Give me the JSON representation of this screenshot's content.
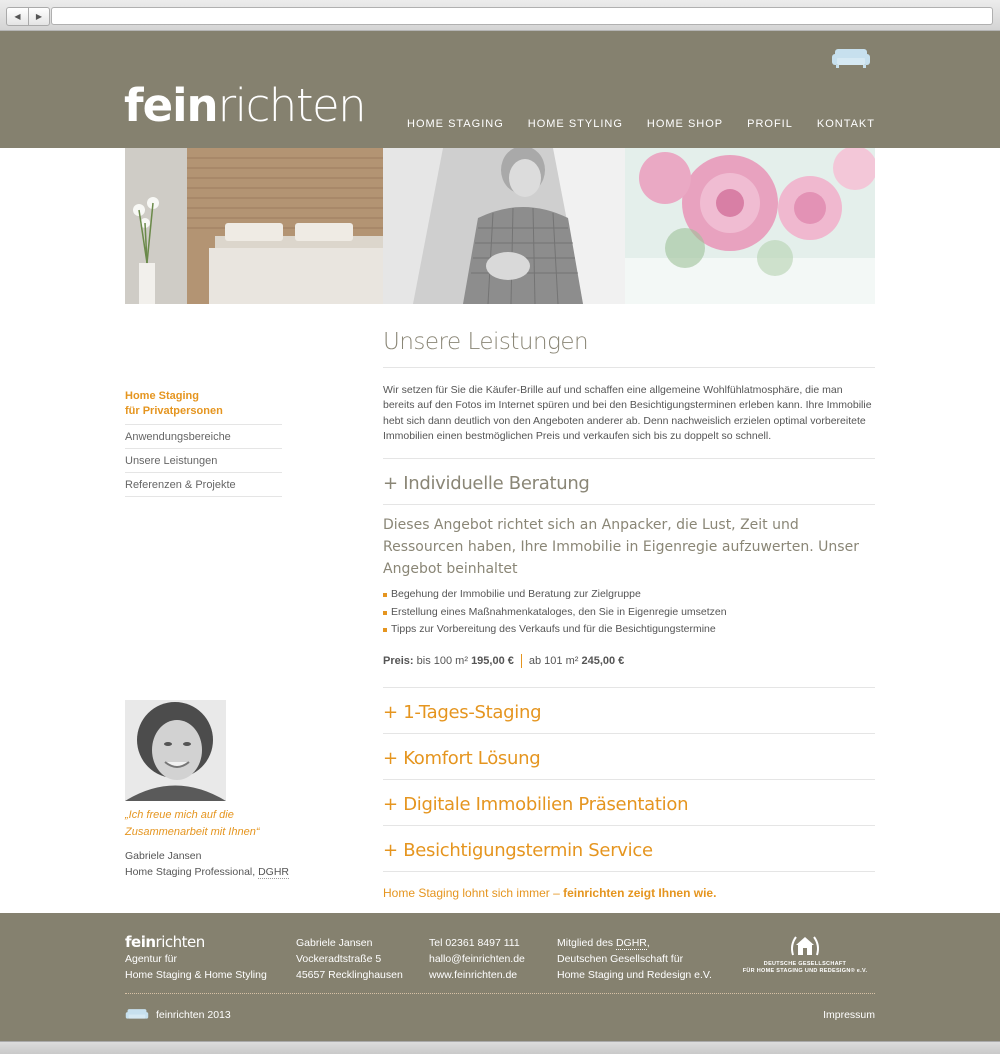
{
  "header": {
    "logo_bold": "fein",
    "logo_light": "richten",
    "nav": [
      "HOME STAGING",
      "HOME STYLING",
      "HOME SHOP",
      "PROFIL",
      "KONTAKT"
    ]
  },
  "sidebar": {
    "active_line1": "Home Staging",
    "active_line2": "für Privatpersonen",
    "items": [
      "Anwendungsbereiche",
      "Unsere Leistungen",
      "Referenzen & Projekte"
    ]
  },
  "main": {
    "title": "Unsere Leistungen",
    "intro": "Wir setzen für Sie die Käufer-Brille auf und schaffen eine allgemeine Wohlfühlatmosphäre, die man bereits auf den Fotos im Internet spüren und bei den Besichtigungsterminen erleben kann. Ihre Immobilie hebt sich dann deutlich von den Angeboten anderer ab. Denn nachweislich erzielen optimal vorbereitete Immobilien einen bestmöglichen Preis und verkaufen sich bis zu doppelt so schnell.",
    "open_section": {
      "title": "+ Individuelle Beratung",
      "lead": "Dieses Angebot richtet sich an Anpacker, die Lust, Zeit und Ressourcen haben, Ihre Immobilie in Eigenregie aufzuwerten. Unser Angebot beinhaltet",
      "bullets": [
        "Begehung der Immobilie und Beratung zur Zielgruppe",
        "Erstellung eines Maßnahmenkataloges, den Sie in Eigenregie umsetzen",
        "Tipps zur Vorbereitung des Verkaufs und für die Besichtigungstermine"
      ],
      "price_label": "Preis:",
      "price_a_text": "bis 100 m²",
      "price_a_value": "195,00 €",
      "price_b_text": "ab 101 m²",
      "price_b_value": "245,00 €"
    },
    "sections": [
      "+ 1-Tages-Staging",
      "+ Komfort Lösung",
      "+ Digitale Immobilien Präsentation",
      "+ Besichtigungstermin Service"
    ],
    "tagline_text": "Home Staging lohnt sich immer – ",
    "tagline_bold": "feinrichten zeigt Ihnen wie."
  },
  "profile": {
    "quote_line1": "„Ich freue mich auf die",
    "quote_line2": "Zusammenarbeit mit Ihnen“",
    "name": "Gabriele Jansen",
    "role": "Home Staging Professional, ",
    "role_link": "DGHR"
  },
  "footer": {
    "logo_bold": "fein",
    "logo_light": "richten",
    "col1": [
      "Agentur für",
      "Home Staging & Home Styling"
    ],
    "col2": [
      "Gabriele Jansen",
      "Vockeradtstraße 5",
      "45657 Recklinghausen"
    ],
    "col3": [
      "Tel 02361 8497 111",
      "hallo@feinrichten.de",
      "www.feinrichten.de"
    ],
    "col4_prefix": "Mitglied des ",
    "col4_link": "DGHR",
    "col4_suffix": ",",
    "col4": [
      "Deutschen Gesellschaft für",
      "Home Staging und Redesign e.V."
    ],
    "seal_line1": "DEUTSCHE GESELLSCHAFT",
    "seal_line2": "FÜR HOME STAGING UND REDESIGN® e.V.",
    "copyright": "feinrichten 2013",
    "impressum": "Impressum"
  },
  "colors": {
    "header_bg": "#85816f",
    "accent": "#e5951f",
    "heading": "#8a8676"
  }
}
